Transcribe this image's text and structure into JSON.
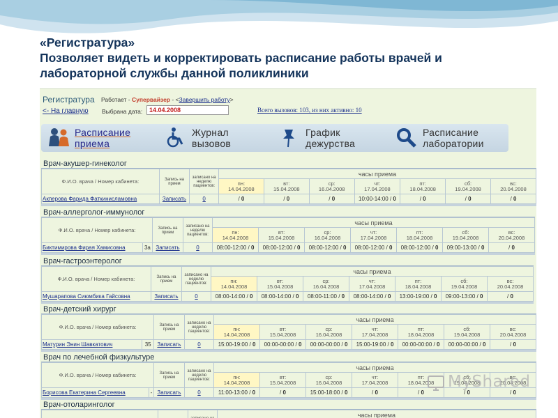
{
  "slide": {
    "heading": "«Регистратура»",
    "subheading": "Позволяет видеть и корректировать расписание работы врачей и лабораторной службы данной поликлиники"
  },
  "app": {
    "name": "Регистратура",
    "works_prefix": "Работает -",
    "role": "Супервайзер",
    "finish_link": "Завершить работу",
    "home_link": "<- На главную",
    "date_label": "Выбрана дата:",
    "date_value": "14.04.2008",
    "calls_text": "Всего вызовов: 103, из них активно: 10"
  },
  "menu": [
    {
      "label": "Расписание приема",
      "icon": "doctors-icon"
    },
    {
      "label": "Журнал вызовов",
      "icon": "wheelchair-icon"
    },
    {
      "label": "График дежурства",
      "icon": "pin-icon"
    },
    {
      "label": "Расписание лаборатории",
      "icon": "magnifier-icon"
    }
  ],
  "table_headers": {
    "fio": "Ф.И.О. врача / Номер кабинета:",
    "signup": "Запись на прием",
    "booked": "записано на неделю пациентов:",
    "hours": "часы приема"
  },
  "days": [
    {
      "abbr": "пн:",
      "date": "14.04.2008"
    },
    {
      "abbr": "вт:",
      "date": "15.04.2008"
    },
    {
      "abbr": "ср:",
      "date": "16.04.2008"
    },
    {
      "abbr": "чт:",
      "date": "17.04.2008"
    },
    {
      "abbr": "пт:",
      "date": "18.04.2008"
    },
    {
      "abbr": "сб:",
      "date": "19.04.2008"
    },
    {
      "abbr": "вс:",
      "date": "20.04.2008"
    }
  ],
  "doctors": [
    {
      "specialty": "Врач-акушер-гинеколог",
      "name": "Акперова Фарида Фаткинисламовна",
      "room": "",
      "signup": "Записать",
      "booked": "0",
      "slots": [
        [
          "",
          "0"
        ],
        [
          "",
          "0"
        ],
        [
          "",
          "0"
        ],
        [
          "10:00-14:00",
          "0"
        ],
        [
          "",
          "0"
        ],
        [
          "",
          "0"
        ],
        [
          "",
          "0"
        ]
      ]
    },
    {
      "specialty": "Врач-аллерголог-иммунолог",
      "name": "Биктимирова Фирая Хамисовна",
      "room": "3а",
      "signup": "Записать",
      "booked": "0",
      "slots": [
        [
          "08:00-12:00",
          "0"
        ],
        [
          "08:00-12:00",
          "0"
        ],
        [
          "08:00-12:00",
          "0"
        ],
        [
          "08:00-12:00",
          "0"
        ],
        [
          "08:00-12:00",
          "0"
        ],
        [
          "09:00-13:00",
          "0"
        ],
        [
          "",
          "0"
        ]
      ]
    },
    {
      "specialty": "Врач-гастроэнтеролог",
      "name": "Мушарапова Сиюмбика Гайсовна",
      "room": "",
      "signup": "Записать",
      "booked": "0",
      "slots": [
        [
          "08:00-14:00",
          "0"
        ],
        [
          "08:00-14:00",
          "0"
        ],
        [
          "08:00-11:00",
          "0"
        ],
        [
          "08:00-14:00",
          "0"
        ],
        [
          "13:00-19:00",
          "0"
        ],
        [
          "09:00-13:00",
          "0"
        ],
        [
          "",
          "0"
        ]
      ]
    },
    {
      "specialty": "Врач-детский хирург",
      "name": "Матурин Энин Шавкатович",
      "room": "35",
      "signup": "Записать",
      "booked": "0",
      "slots": [
        [
          "15:00-19:00",
          "0"
        ],
        [
          "00:00-00:00",
          "0"
        ],
        [
          "00:00-00:00",
          "0"
        ],
        [
          "15:00-19:00",
          "0"
        ],
        [
          "00:00-00:00",
          "0"
        ],
        [
          "00:00-00:00",
          "0"
        ],
        [
          "",
          "0"
        ]
      ]
    },
    {
      "specialty": "Врач по лечебной физкультуре",
      "name": "Борисова Екатерина Сергеевна",
      "room": "-",
      "signup": "Записать",
      "booked": "0",
      "slots": [
        [
          "11:00-13:00",
          "0"
        ],
        [
          "",
          "0"
        ],
        [
          "15:00-18:00",
          "0"
        ],
        [
          "",
          "0"
        ],
        [
          "",
          "0"
        ],
        [
          "",
          "0"
        ],
        [
          "",
          "0"
        ]
      ]
    },
    {
      "specialty": "Врач-отоларинголог",
      "name": "",
      "room": "",
      "signup": "",
      "booked": "",
      "slots": []
    }
  ],
  "watermark": "MyShared"
}
